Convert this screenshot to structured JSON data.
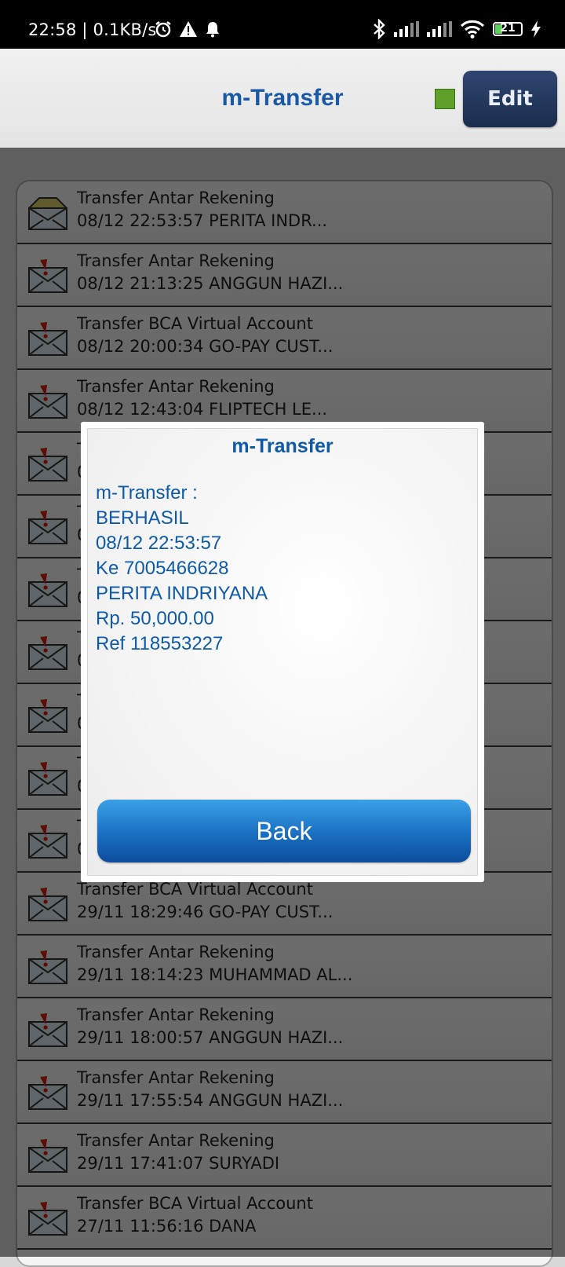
{
  "status_bar": {
    "time": "22:58 | 0.1KB/s",
    "battery": "21"
  },
  "header": {
    "title": "m-Transfer",
    "edit_label": "Edit",
    "indicator_color": "#5fa02a"
  },
  "messages": [
    {
      "line1": "Transfer Antar Rekening",
      "line2": "08/12 22:53:57 PERITA INDR...",
      "icon": "envelope-open-icon"
    },
    {
      "line1": "Transfer Antar Rekening",
      "line2": "08/12 21:13:25 ANGGUN HAZI...",
      "icon": "envelope-unread-icon"
    },
    {
      "line1": "Transfer BCA Virtual Account",
      "line2": "08/12 20:00:34 GO-PAY CUST...",
      "icon": "envelope-unread-icon"
    },
    {
      "line1": "Transfer Antar Rekening",
      "line2": "08/12 12:43:04 FLIPTECH LE...",
      "icon": "envelope-unread-icon"
    },
    {
      "line1": "T",
      "line2": "0",
      "icon": "envelope-unread-icon"
    },
    {
      "line1": "T",
      "line2": "0",
      "icon": "envelope-unread-icon"
    },
    {
      "line1": "T",
      "line2": "0",
      "icon": "envelope-unread-icon"
    },
    {
      "line1": "T",
      "line2": "0",
      "icon": "envelope-unread-icon"
    },
    {
      "line1": "T",
      "line2": "0",
      "icon": "envelope-unread-icon"
    },
    {
      "line1": "T",
      "line2": "0",
      "icon": "envelope-unread-icon"
    },
    {
      "line1": "T",
      "line2": "0",
      "icon": "envelope-unread-icon"
    },
    {
      "line1": "Transfer BCA Virtual Account",
      "line2": "29/11 18:29:46 GO-PAY CUST...",
      "icon": "envelope-unread-icon"
    },
    {
      "line1": "Transfer Antar Rekening",
      "line2": "29/11 18:14:23 MUHAMMAD AL...",
      "icon": "envelope-unread-icon"
    },
    {
      "line1": "Transfer Antar Rekening",
      "line2": "29/11 18:00:57 ANGGUN HAZI...",
      "icon": "envelope-unread-icon"
    },
    {
      "line1": "Transfer Antar Rekening",
      "line2": "29/11 17:55:54 ANGGUN HAZI...",
      "icon": "envelope-unread-icon"
    },
    {
      "line1": "Transfer Antar Rekening",
      "line2": "29/11 17:41:07 SURYADI",
      "icon": "envelope-unread-icon"
    },
    {
      "line1": "Transfer BCA Virtual Account",
      "line2": "27/11 11:56:16 DANA",
      "icon": "envelope-unread-icon"
    }
  ],
  "dialog": {
    "title": "m-Transfer",
    "lines": [
      "m-Transfer :",
      "BERHASIL",
      "08/12 22:53:57",
      "Ke 7005466628",
      "PERITA INDRIYANA",
      "Rp. 50,000.00",
      "Ref 118553227"
    ],
    "back_label": "Back"
  }
}
